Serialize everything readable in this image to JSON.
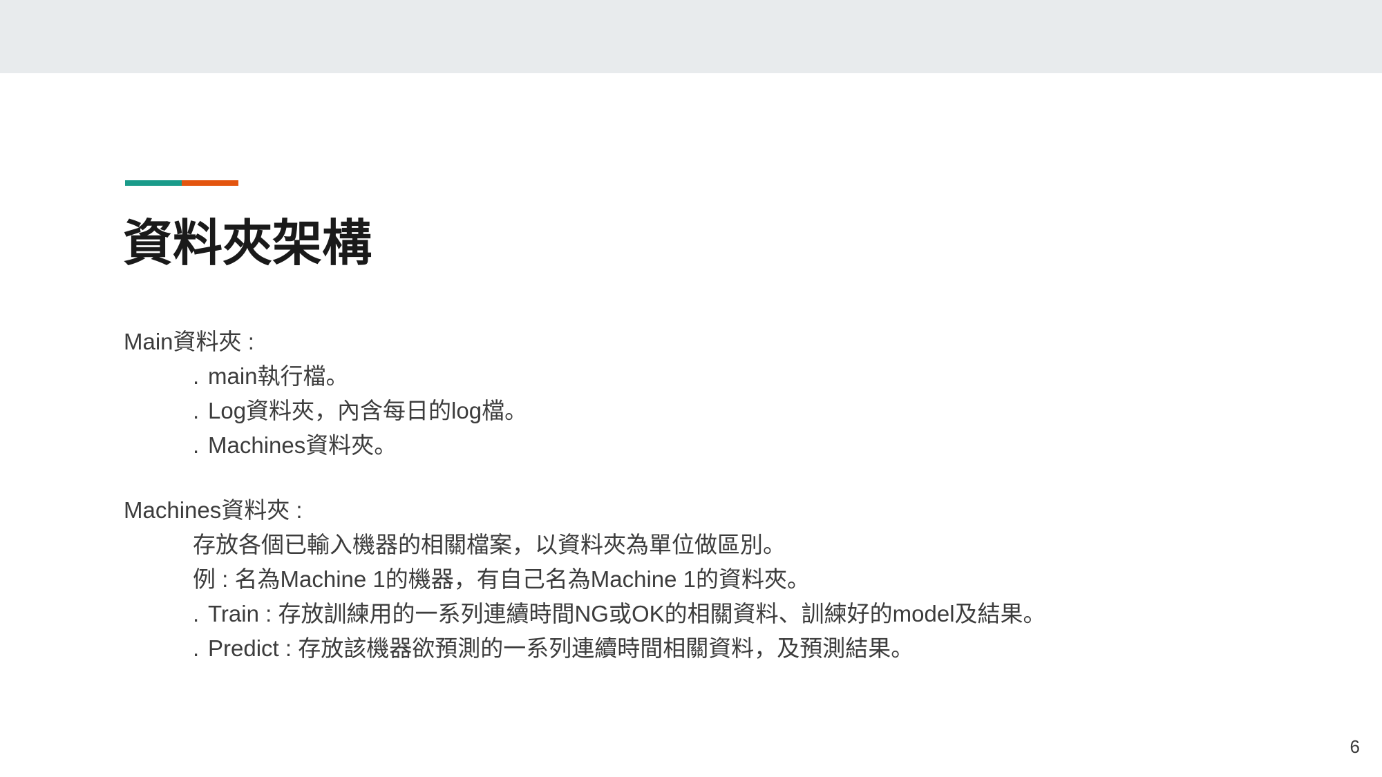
{
  "slide": {
    "title": "資料夾架構",
    "page_number": "6",
    "colors": {
      "accent_teal": "#1a9b8a",
      "accent_orange": "#e3550f",
      "top_band": "#e8ebed",
      "text": "#3c3c3c"
    },
    "sections": [
      {
        "heading": "Main資料夾 :",
        "lines": [
          {
            "bullet": ".",
            "text": "main執行檔。"
          },
          {
            "bullet": ".",
            "text": "Log資料夾，內含每日的log檔。"
          },
          {
            "bullet": ".",
            "text": "Machines資料夾。"
          }
        ]
      },
      {
        "heading": "Machines資料夾 :",
        "lines": [
          {
            "bullet": "",
            "text": "存放各個已輸入機器的相關檔案，以資料夾為單位做區別。"
          },
          {
            "bullet": "",
            "text": "例 : 名為Machine 1的機器，有自己名為Machine 1的資料夾。"
          },
          {
            "bullet": ".",
            "text": "Train : 存放訓練用的一系列連續時間NG或OK的相關資料、訓練好的model及結果。"
          },
          {
            "bullet": ".",
            "text": "Predict : 存放該機器欲預測的一系列連續時間相關資料，及預測結果。"
          }
        ]
      }
    ]
  }
}
